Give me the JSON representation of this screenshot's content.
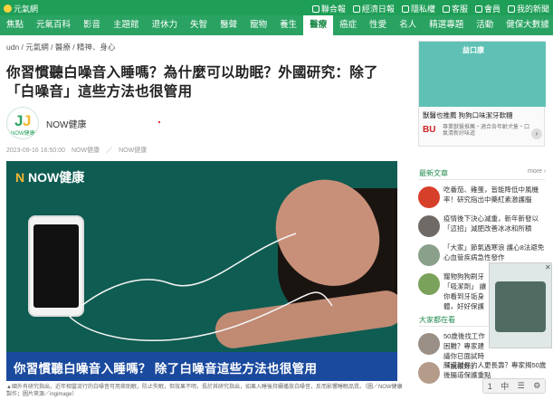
{
  "top_bar": {
    "brand": "元氣網",
    "utilities": [
      "聯合報",
      "經濟日報",
      "隱私權",
      "客服",
      "會員",
      "我的新聞"
    ]
  },
  "nav": {
    "items": [
      "焦點",
      "元氣百科",
      "影音",
      "主題館",
      "退休力",
      "失智",
      "醫聲",
      "寵物",
      "養生",
      "醫療",
      "癌症",
      "性愛",
      "名人",
      "精選專題",
      "活動",
      "健保大數據"
    ],
    "active_index": 9
  },
  "breadcrumb": "udn / 元氣網 / 醫療 / 精神．身心",
  "article": {
    "title": "你習慣聽白噪音入睡嗎？為什麼可以助眠？外國研究：除了「白噪音」這些方法也很管用",
    "author": "NOW健康",
    "avatar_text": "NOW健康",
    "meta": "2023-09-16 16:50:00　NOW健康　／　NOW健康",
    "hero": {
      "logo_prefix": "N",
      "logo_text": "NOW健康",
      "caption": "你習慣聽白噪音入睡嗎？ 除了白噪音這些方法也很管用"
    },
    "image_note": "▲國外有研究指出，近年相當流行的白噪音可用來助眠，防止失眠，但效果不明，長於其研究指出，如果入睡後持續播放白噪音，反而影響睡眠品質。（圖／NOW健康製作；圖片來源／ingimage）"
  },
  "ad": {
    "brand": "益口康",
    "title": "獸醫也推薦 狗狗口味潔牙軟糖",
    "logo": "BU",
    "desc": "專業獸醫推薦・適合各年齡犬隻・口氣清新好味道"
  },
  "latest": {
    "title": "最新文章",
    "more": "more ›",
    "items": [
      "吃番茄、雞蛋，皆能降低中風機率！研究指出中藥紅素激護腦",
      "疫情後下決心減重，新年新發以「這招」減肥改善冰冰和所積",
      "「大家」節氣過寒浪 護心8法避免心血管疾病急性發作",
      "寵物狗狗刷牙「吸潔劑」 讓你看到牙垢身體，好好保護"
    ]
  },
  "popular": {
    "title": "大家都在看",
    "items": [
      "50歲後找工作困難？專家建議你已面試時「說很好」",
      "腸道越長的人更長壽？專家揭50歲後腸道保護重點"
    ]
  },
  "toolbar": [
    "1",
    "中",
    "☰"
  ]
}
